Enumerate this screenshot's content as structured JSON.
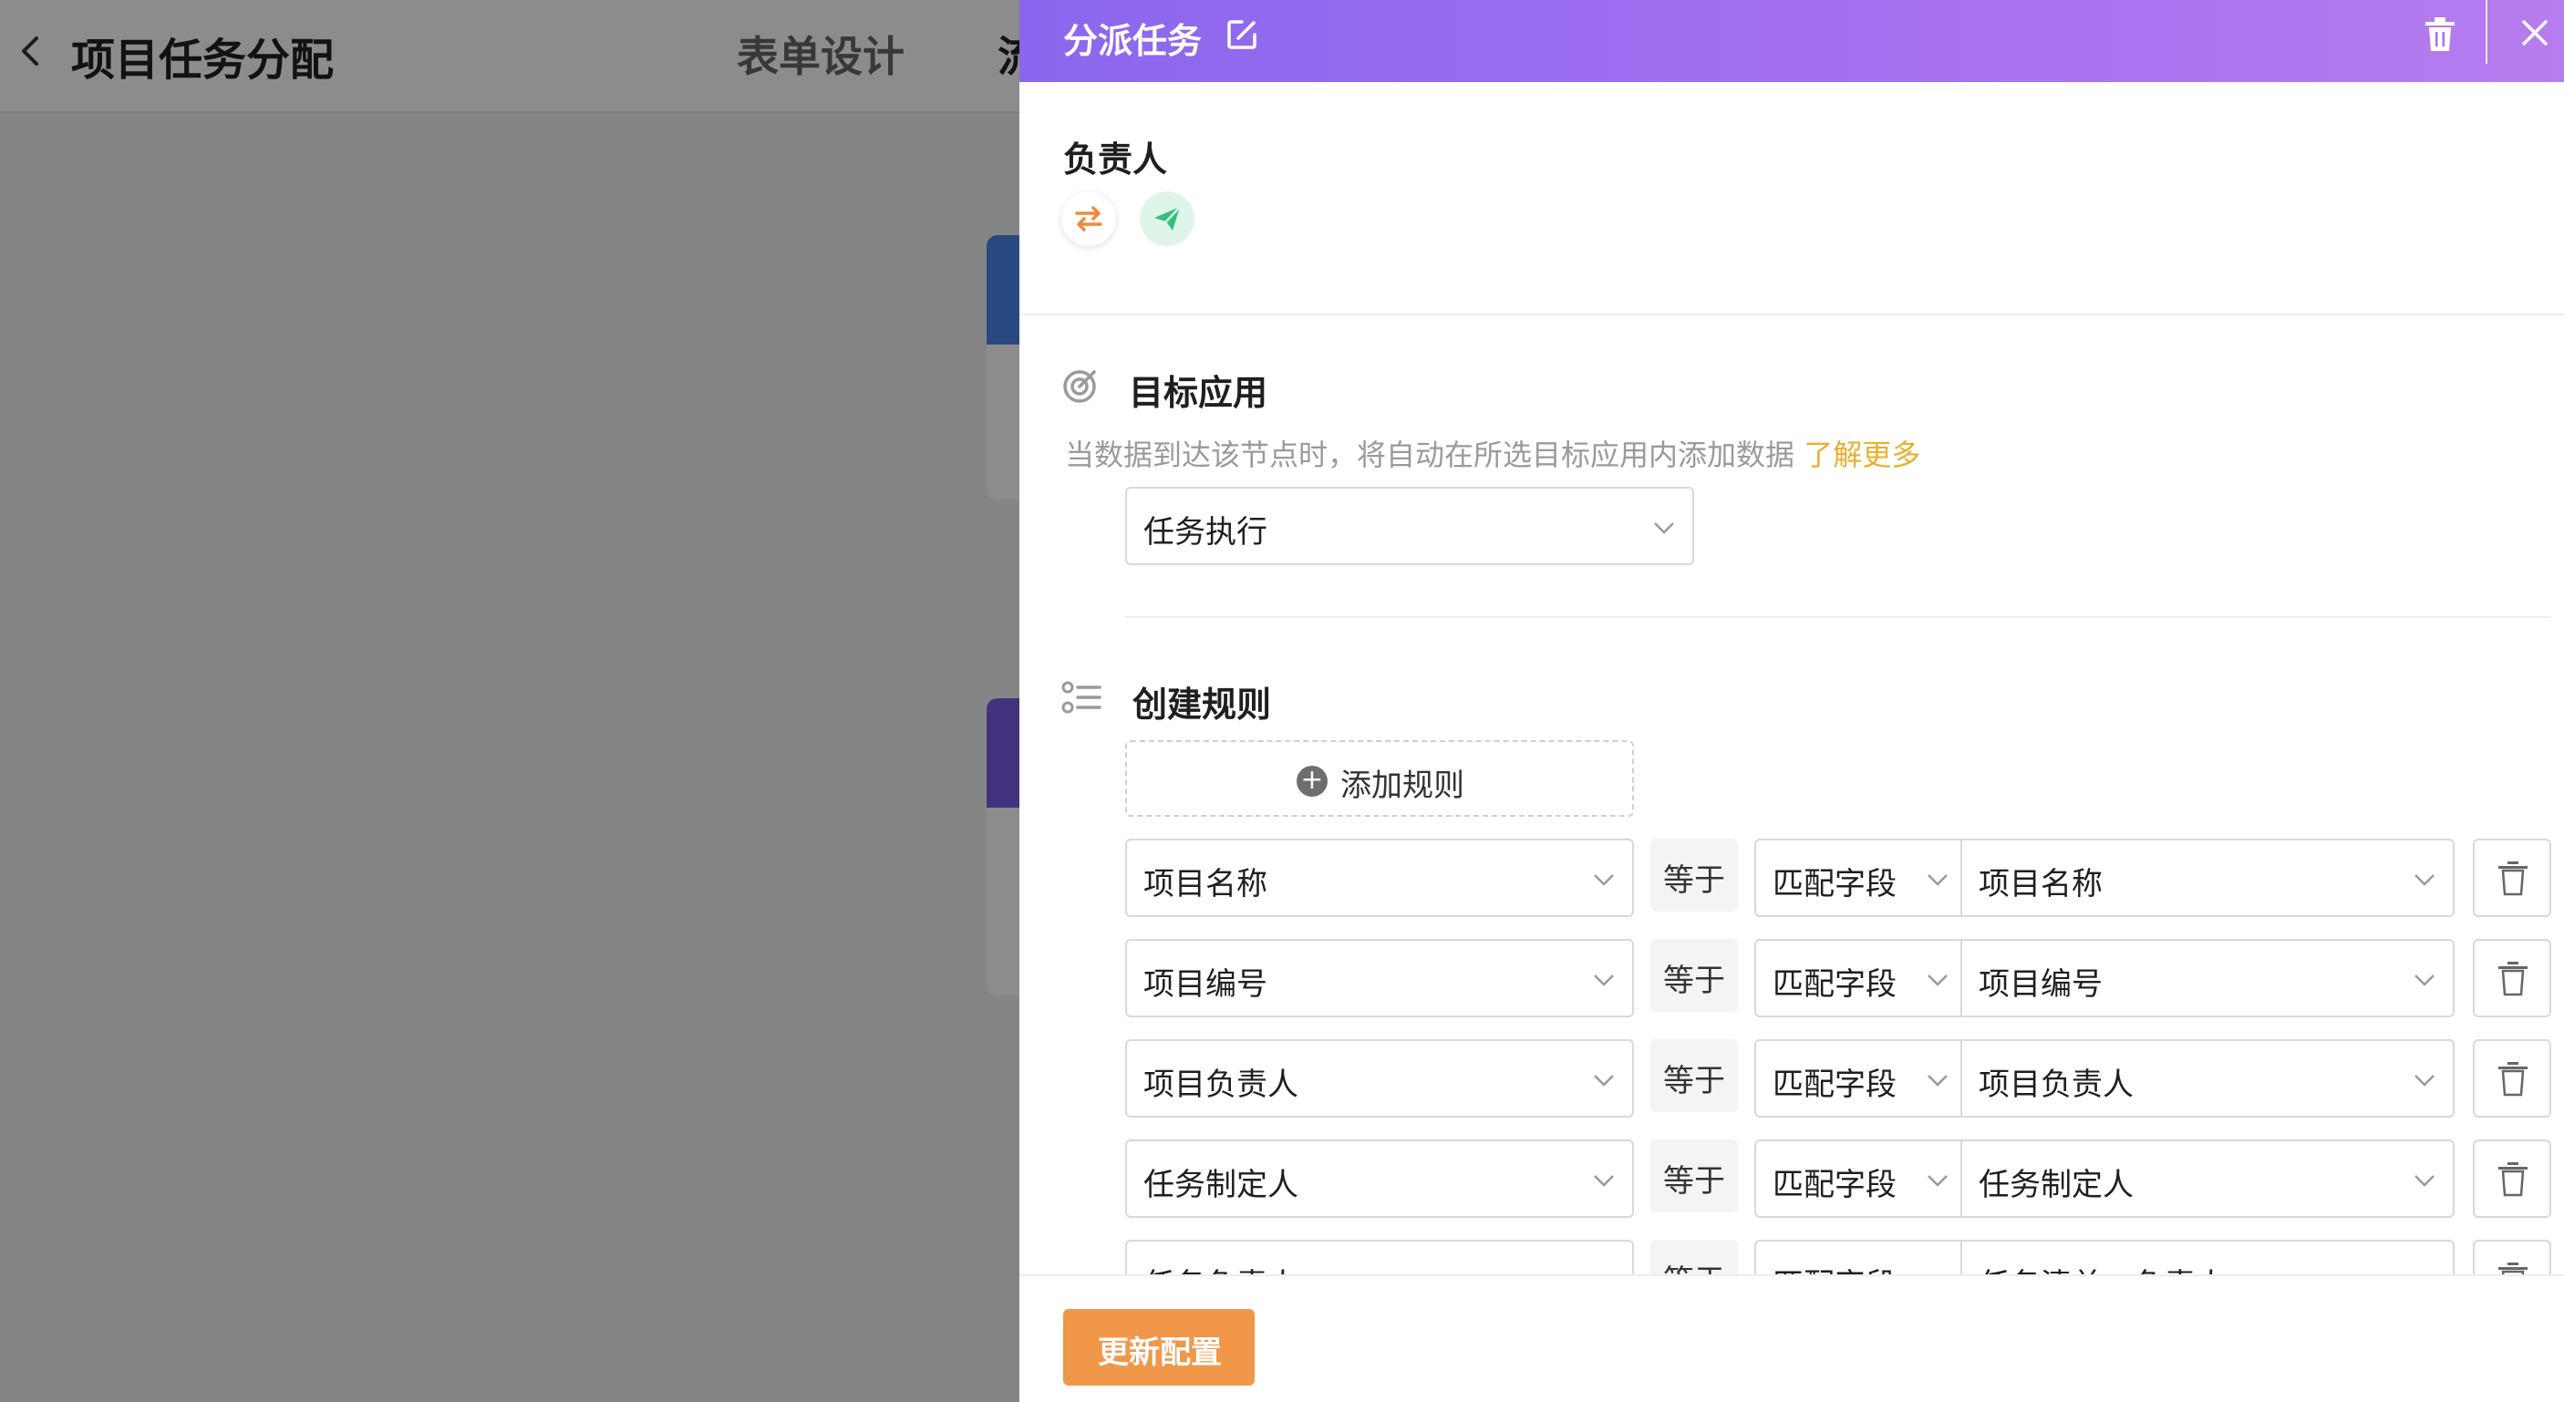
{
  "page": {
    "title": "项目任务分配",
    "tabs": [
      "表单设计",
      "流"
    ]
  },
  "drawer": {
    "title": "分派任务",
    "assignee_label": "负责人",
    "target_app": {
      "label": "目标应用",
      "hint": "当数据到达该节点时，将自动在所选目标应用内添加数据",
      "learn_more": "了解更多",
      "selected": "任务执行"
    },
    "rules": {
      "label": "创建规则",
      "add_label": "添加规则",
      "plus": "+",
      "items": [
        {
          "field": "项目名称",
          "op": "等于",
          "mode": "匹配字段",
          "target": "项目名称"
        },
        {
          "field": "项目编号",
          "op": "等于",
          "mode": "匹配字段",
          "target": "项目编号"
        },
        {
          "field": "项目负责人",
          "op": "等于",
          "mode": "匹配字段",
          "target": "项目负责人"
        },
        {
          "field": "任务制定人",
          "op": "等于",
          "mode": "匹配字段",
          "target": "任务制定人"
        },
        {
          "field": "任务负责人",
          "op": "等于",
          "mode": "匹配字段",
          "target": "任务清单 - 负责人"
        }
      ]
    },
    "footer": {
      "update_label": "更新配置"
    }
  },
  "colors": {
    "header_gradient_start": "#8a67ee",
    "header_gradient_end": "#b77cef",
    "link": "#e7b032",
    "primary_button": "#f0974a",
    "swap_icon": "#ef8a3d",
    "send_icon": "#2fc27a"
  },
  "icons": [
    "back-icon",
    "edit-icon",
    "trash-icon",
    "close-icon",
    "swap-icon",
    "send-icon",
    "target-icon",
    "list-icon",
    "chevron-down-icon",
    "plus-icon"
  ]
}
